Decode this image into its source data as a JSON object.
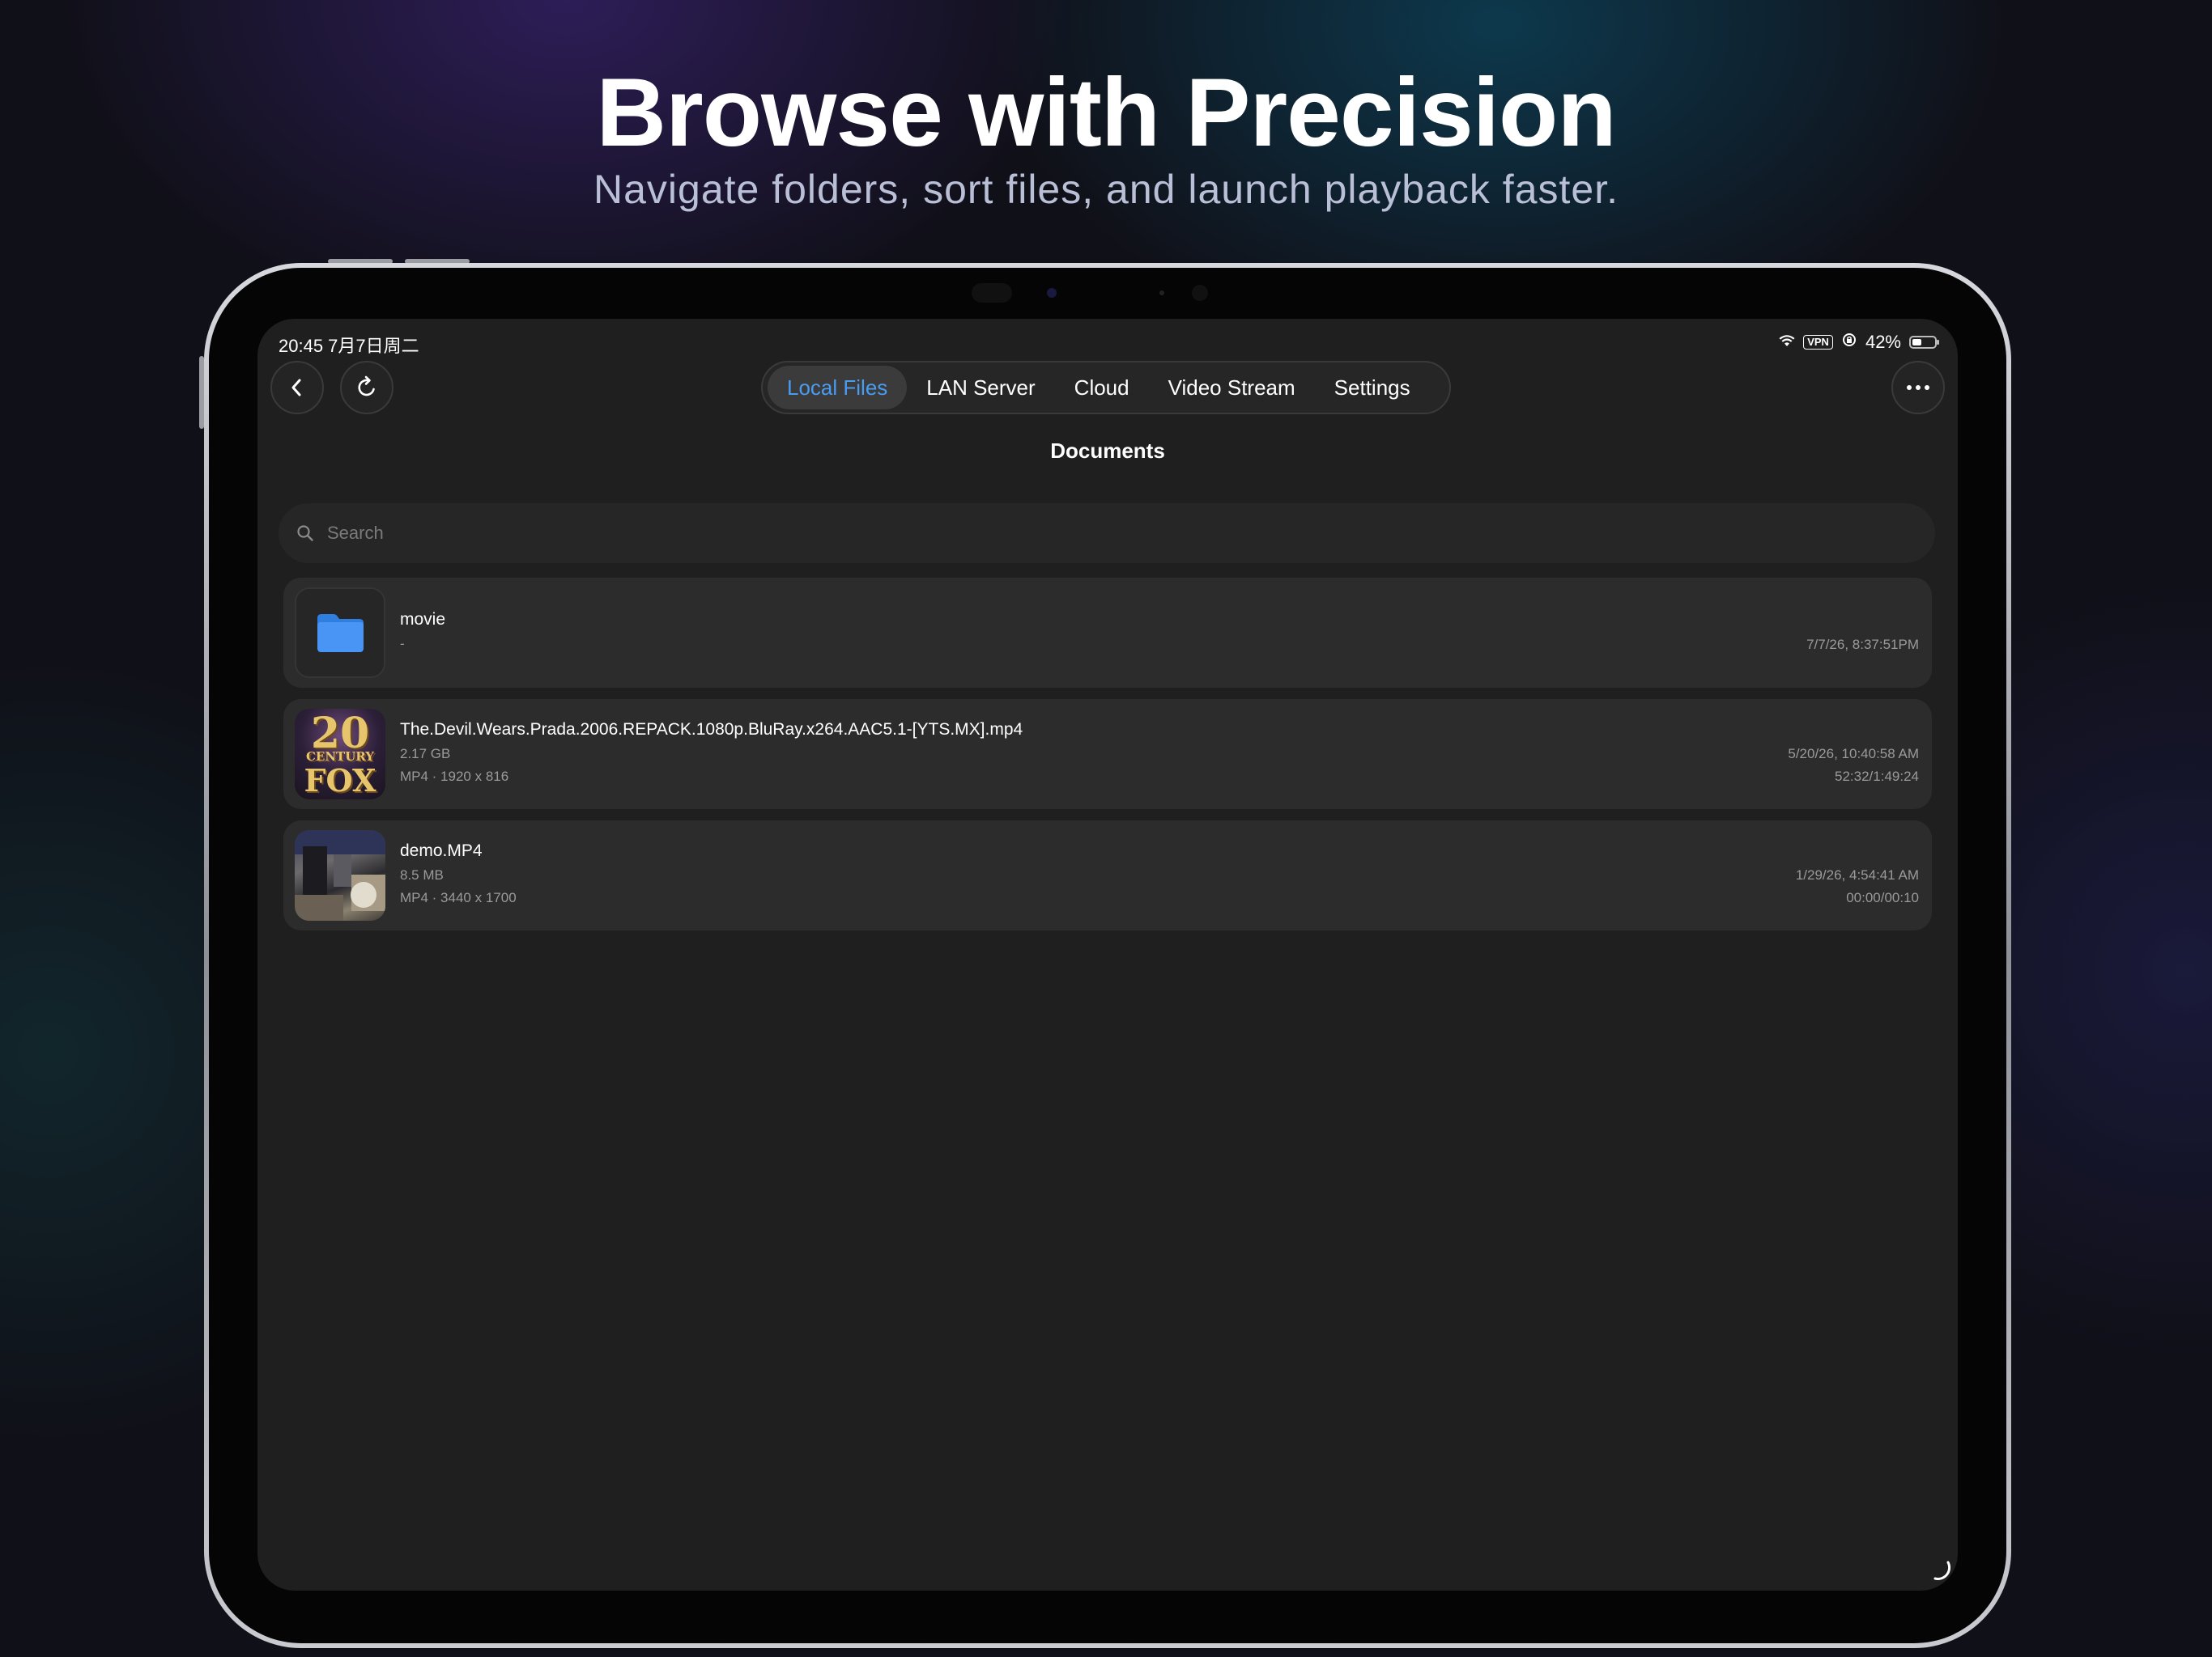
{
  "marketing": {
    "headline": "Browse with Precision",
    "subheadline": "Navigate folders, sort files, and launch playback faster."
  },
  "status_bar": {
    "time_date": "20:45  7月7日周二",
    "vpn": "VPN",
    "battery": "42%",
    "battery_level": 0.42
  },
  "toolbar": {
    "back_icon": "chevron-left-icon",
    "refresh_icon": "refresh-icon",
    "more_icon": "more-horizontal-icon"
  },
  "tabs": [
    {
      "label": "Local Files",
      "active": true
    },
    {
      "label": "LAN Server",
      "active": false
    },
    {
      "label": "Cloud",
      "active": false
    },
    {
      "label": "Video Stream",
      "active": false
    },
    {
      "label": "Settings",
      "active": false
    }
  ],
  "page": {
    "title": "Documents"
  },
  "search": {
    "placeholder": "Search",
    "value": ""
  },
  "files": [
    {
      "type": "folder",
      "icon": "folder-icon",
      "name": "movie",
      "size": "-",
      "date": "7/7/26, 8:37:51PM"
    },
    {
      "type": "video",
      "name": "The.Devil.Wears.Prada.2006.REPACK.1080p.BluRay.x264.AAC5.1-[YTS.MX].mp4",
      "size": "2.17 GB",
      "meta": "MP4 · 1920 x 816",
      "date": "5/20/26, 10:40:58 AM",
      "progress": "52:32/1:49:24",
      "thumb_text_top": "20",
      "thumb_text_mid": "CENTURY",
      "thumb_text_bottom": "FOX"
    },
    {
      "type": "video",
      "name": "demo.MP4",
      "size": "8.5 MB",
      "meta": "MP4 · 3440 x 1700",
      "date": "1/29/26, 4:54:41 AM",
      "progress": "00:00/00:10"
    }
  ],
  "colors": {
    "accent": "#4a9cf0",
    "folder": "#3d8ef0",
    "screen_bg": "#1f1f1f",
    "row_bg": "#2c2c2c"
  }
}
